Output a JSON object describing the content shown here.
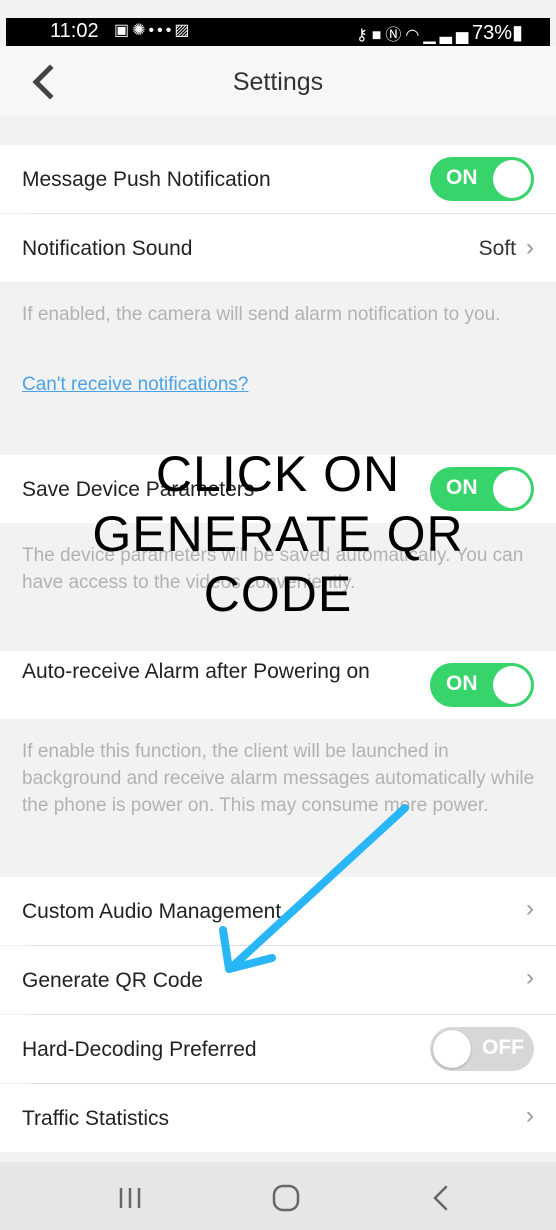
{
  "status_bar": {
    "time": "11:02",
    "left_icons": [
      "calendar-icon",
      "settings-icon",
      "dots-icon",
      "image-icon"
    ],
    "right_icons": [
      "key-icon",
      "lock-icon",
      "nfc-icon",
      "wifi-icon",
      "signal-icon"
    ],
    "battery": "73%"
  },
  "header": {
    "title": "Settings"
  },
  "settings": {
    "push_notification": {
      "label": "Message Push Notification",
      "state": "ON"
    },
    "notification_sound": {
      "label": "Notification Sound",
      "value": "Soft"
    },
    "notification_note": "If enabled, the camera will send alarm notification to you.",
    "notification_link": "Can't receive notifications?",
    "save_params": {
      "label": "Save Device Parameters",
      "state": "ON"
    },
    "save_params_note": "The device parameters will be saved automatically. You can have access to the videos conveniently.",
    "auto_receive": {
      "label": "Auto-receive Alarm after Powering on",
      "state": "ON"
    },
    "auto_receive_note": "If enable this function, the client will be launched in background and receive alarm messages automatically while the phone is power on. This may consume more power.",
    "custom_audio": {
      "label": "Custom Audio Management"
    },
    "generate_qr": {
      "label": "Generate QR Code"
    },
    "hard_decoding": {
      "label": "Hard-Decoding Preferred",
      "state": "OFF"
    },
    "traffic": {
      "label": "Traffic Statistics"
    }
  },
  "annotation": {
    "text": "CLICK ON GENERATE QR CODE",
    "color": "#29b6f6"
  },
  "colors": {
    "toggle_on": "#37d36b",
    "toggle_off": "#d7d7d7",
    "link": "#4aa3e6"
  }
}
